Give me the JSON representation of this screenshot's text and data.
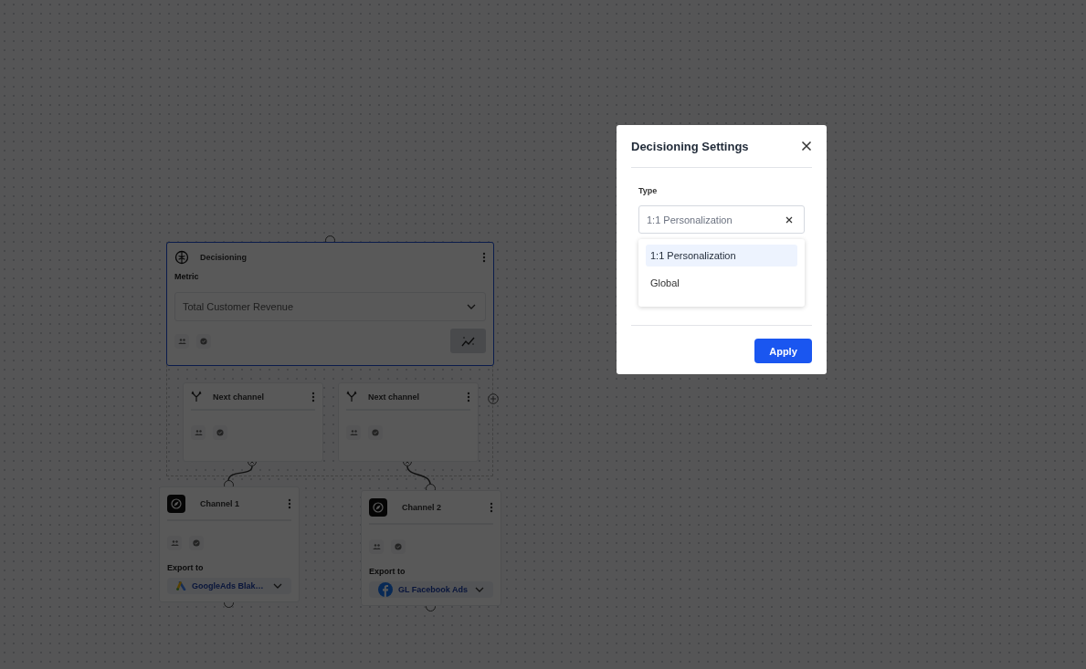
{
  "canvas": {
    "decision_node": {
      "title": "Decisioning",
      "metric_label": "Metric",
      "metric_value": "Total Customer Revenue",
      "selected": true
    },
    "branches": [
      {
        "title": "Next channel"
      },
      {
        "title": "Next channel"
      }
    ],
    "channels": [
      {
        "title": "Channel 1",
        "export_label": "Export to",
        "destination": "GoogleAds Blak…",
        "kind": "google"
      },
      {
        "title": "Channel 2",
        "export_label": "Export to",
        "destination": "GL Facebook Ads",
        "kind": "facebook"
      }
    ]
  },
  "modal": {
    "title": "Decisioning Settings",
    "type_label": "Type",
    "type_field": {
      "value": "1:1 Personalization"
    },
    "options": [
      {
        "label": "1:1 Personalization",
        "selected": true
      },
      {
        "label": "Global",
        "selected": false
      }
    ],
    "apply": "Apply"
  }
}
